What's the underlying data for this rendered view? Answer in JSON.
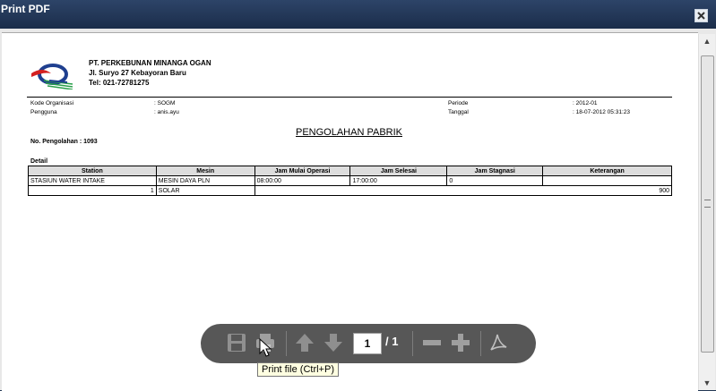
{
  "window": {
    "title": "Print PDF"
  },
  "company": {
    "name": "PT. PERKEBUNAN MINANGA OGAN",
    "address": "Jl. Suryo 27 Kebayoran Baru",
    "phone": "Tel: 021-72781275"
  },
  "meta": {
    "kode_label": "Kode Organisasi",
    "kode_value": ": SOGM",
    "pengguna_label": "Pengguna",
    "pengguna_value": ": anis.ayu",
    "periode_label": "Periode",
    "periode_value": ": 2012-01",
    "tanggal_label": "Tanggal",
    "tanggal_value": ": 18-07-2012 05:31:23"
  },
  "report": {
    "title": "PENGOLAHAN PABRIK",
    "number": "No. Pengolahan : 1093",
    "detail_label": "Detail"
  },
  "table": {
    "headers": [
      "Station",
      "Mesin",
      "Jam Mulai Operasi",
      "Jam Selesai",
      "Jam Stagnasi",
      "Keterangan"
    ],
    "row1": [
      "STASIUN WATER INTAKE",
      "MESIN DAYA PLN",
      "08:00:00",
      "17:00:00",
      "0",
      ""
    ],
    "row2": {
      "qty": "1",
      "item": "SOLAR",
      "value": "900"
    }
  },
  "toolbar": {
    "page_current": "1",
    "page_total": "/ 1",
    "tooltip": "Print file (Ctrl+P)"
  },
  "icons": [
    "close-icon",
    "save-icon",
    "print-icon",
    "arrow-up-icon",
    "arrow-down-icon",
    "zoom-out-icon",
    "zoom-in-icon",
    "acrobat-icon",
    "cursor-icon"
  ]
}
